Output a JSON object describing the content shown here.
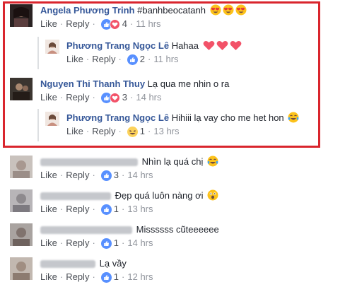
{
  "actions": {
    "like": "Like",
    "reply": "Reply",
    "sep": "·"
  },
  "comments": [
    {
      "name": "Angela Phương Trinh",
      "text": "#banhbeocatanh",
      "count": "4",
      "time": "11 hrs"
    },
    {
      "name": "Phương Trang Ngọc Lê",
      "text": "Hahaa",
      "count": "2",
      "time": "11 hrs"
    },
    {
      "name": "Nguyen Thi Thanh Thuy",
      "text": "Lạ qua me nhin o ra",
      "count": "3",
      "time": "14 hrs"
    },
    {
      "name": "Phương Trang Ngọc Lê",
      "text": "Hihiii lạ vay cho me het hon",
      "count": "1",
      "time": "13 hrs"
    },
    {
      "name": "",
      "text": "Nhìn lạ quá chị",
      "count": "3",
      "time": "14 hrs"
    },
    {
      "name": "",
      "text": "Đẹp quá luôn nàng ơi",
      "count": "1",
      "time": "13 hrs"
    },
    {
      "name": "",
      "text": "Missssss cũteeeeee",
      "count": "1",
      "time": "14 hrs"
    },
    {
      "name": "",
      "text": "Lạ vầy",
      "count": "1",
      "time": "12 hrs"
    }
  ],
  "colors": {
    "highlight": "#d9252d",
    "link": "#365899",
    "like": "#5890ff",
    "love": "#f25268",
    "haha": "#fcd25b"
  }
}
